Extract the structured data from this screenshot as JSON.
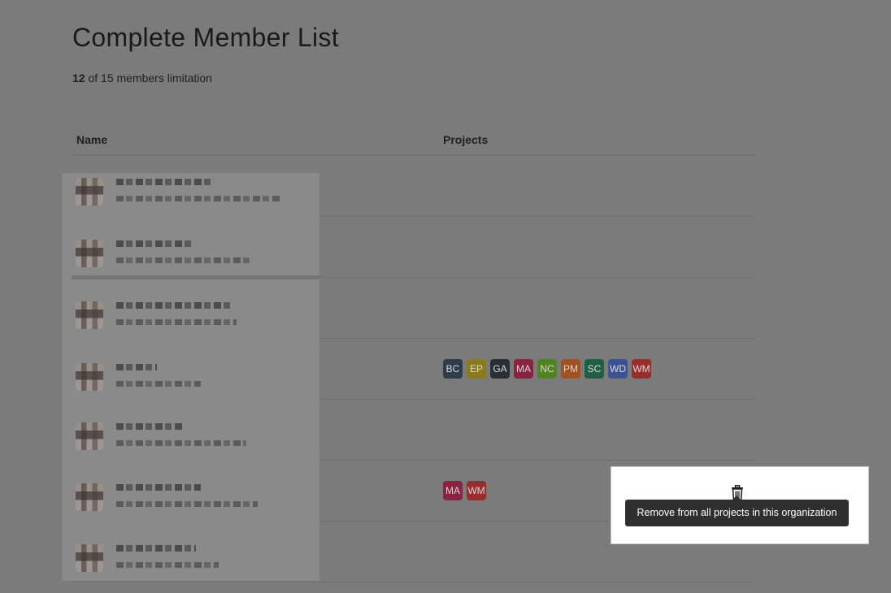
{
  "page": {
    "title": "Complete Member List",
    "member_count": "12",
    "member_limit_text": "of 15 members limitation"
  },
  "table": {
    "columns": [
      "Name",
      "Projects"
    ],
    "rows": [
      {
        "projects": []
      },
      {
        "projects": []
      },
      {
        "projects": []
      },
      {
        "projects": [
          {
            "label": "BC",
            "color": "#2f3d4a"
          },
          {
            "label": "EP",
            "color": "#8a7a1c"
          },
          {
            "label": "GA",
            "color": "#2a2f35"
          },
          {
            "label": "MA",
            "color": "#8a2242"
          },
          {
            "label": "NC",
            "color": "#4f8420"
          },
          {
            "label": "PM",
            "color": "#a35121"
          },
          {
            "label": "SC",
            "color": "#1f5f46"
          },
          {
            "label": "WD",
            "color": "#3d5197"
          },
          {
            "label": "WM",
            "color": "#992d2d"
          }
        ]
      },
      {
        "projects": []
      },
      {
        "projects": [
          {
            "label": "MA",
            "color": "#8a2242"
          },
          {
            "label": "WM",
            "color": "#992d2d"
          }
        ]
      },
      {
        "projects": []
      }
    ]
  },
  "popup": {
    "icon": "trash-icon",
    "tooltip": "Remove from all projects in this organization"
  }
}
